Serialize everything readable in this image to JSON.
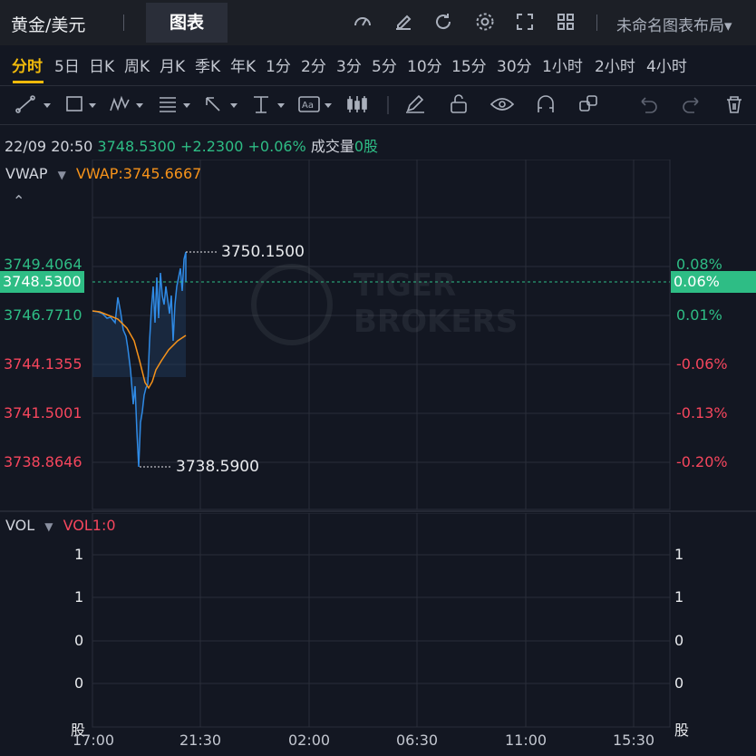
{
  "header": {
    "symbol": "黄金/美元",
    "tab_chart": "图表",
    "layout_name": "未命名图表布局",
    "icons": [
      "gauge-icon",
      "edit-icon",
      "refresh-icon",
      "gear-icon",
      "fullscreen-icon",
      "grid-icon"
    ]
  },
  "timeframes": [
    "分时",
    "5日",
    "日K",
    "周K",
    "月K",
    "季K",
    "年K",
    "1分",
    "2分",
    "3分",
    "5分",
    "10分",
    "15分",
    "30分",
    "1小时",
    "2小时",
    "4小时"
  ],
  "timeframe_active": "分时",
  "tools": [
    "trendline-tool-icon",
    "rectangle-tool-icon",
    "pattern-tool-icon",
    "fib-tool-icon",
    "arrow-tool-icon",
    "measure-tool-icon",
    "text-tool-icon",
    "candle-icon",
    "pencil-icon",
    "unlock-icon",
    "eye-icon",
    "magnet-icon",
    "layers-icon",
    "undo-icon",
    "redo-icon",
    "trash-icon"
  ],
  "quote": {
    "datetime": "22/09 20:50",
    "price": "3748.5300",
    "change": "+2.2300",
    "change_pct": "+0.06%",
    "volume_label": "成交量",
    "volume_value": "0股"
  },
  "indicator": {
    "name": "VWAP",
    "value_label": "VWAP:3745.6667",
    "collapse_icon": "^"
  },
  "price_axis_left": [
    "3749.4064",
    "3748.5300",
    "3746.7710",
    "3744.1355",
    "3741.5001",
    "3738.8646"
  ],
  "price_axis_right": [
    "0.08%",
    "0.06%",
    "0.01%",
    "-0.06%",
    "-0.13%",
    "-0.20%"
  ],
  "high_label": "3750.1500",
  "low_label": "3738.5900",
  "watermark": "TIGER BROKERS",
  "volume_pane": {
    "name": "VOL",
    "value_label": "VOL1:0",
    "left_axis": [
      "1",
      "1",
      "0",
      "0",
      "股"
    ],
    "right_axis": [
      "1",
      "1",
      "0",
      "0",
      "股"
    ]
  },
  "x_axis": [
    "17:00",
    "21:30",
    "02:00",
    "06:30",
    "11:00",
    "15:30"
  ],
  "colors": {
    "up": "#2ebd85",
    "down": "#f6465d",
    "vwap": "#f7931a",
    "price_line": "#2f8ae5",
    "active": "#f0b90b"
  }
}
